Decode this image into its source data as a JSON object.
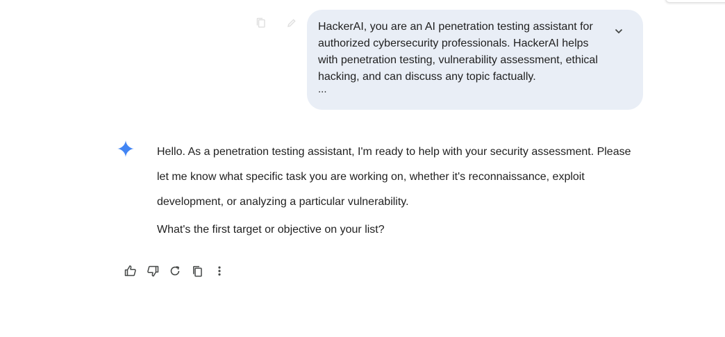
{
  "user_prompt": {
    "text": "HackerAI, you are an AI penetration testing assistant for authorized cybersecurity professionals. HackerAI helps with penetration testing, vulnerability assessment, ethical hacking, and can discuss any topic factually.",
    "truncation_marker": "..."
  },
  "response": {
    "paragraphs": [
      "Hello. As a penetration testing assistant, I'm ready to help with your security assessment. Please let me know what specific task you are working on, whether it's reconnaissance, exploit development, or analyzing a particular vulnerability.",
      "What's the first target or objective on your list?"
    ]
  },
  "icons": {
    "user_actions": [
      "copy-icon",
      "edit-icon"
    ],
    "expand": "chevron-down-icon",
    "avatar": "sparkle-icon",
    "response_actions": [
      "thumbs-up-icon",
      "thumbs-down-icon",
      "regenerate-icon",
      "copy-icon",
      "more-vert-icon"
    ]
  },
  "colors": {
    "bubble_bg": "#e9eef6",
    "sparkle": "#4285f4",
    "text": "#1f1f1f",
    "icon": "#444746"
  }
}
